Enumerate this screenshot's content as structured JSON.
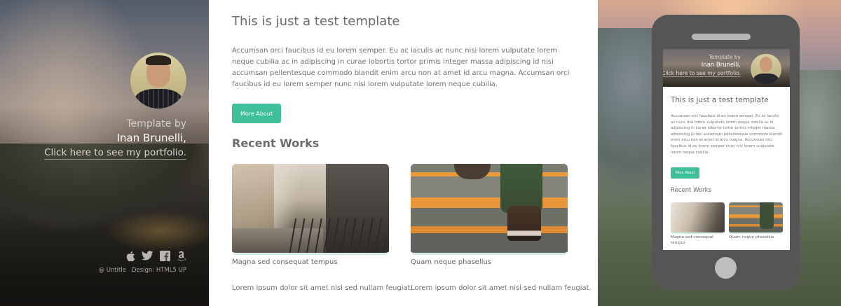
{
  "sidebar": {
    "template_by": "Template by",
    "author": "Inan Brunelli,",
    "portfolio_link": "Click here to see my portfolio.",
    "social_icons": [
      "apple-icon",
      "twitter-icon",
      "facebook-icon",
      "amazon-icon"
    ],
    "copyright": "@ Untitle",
    "design": "Design: HTML5 UP"
  },
  "main": {
    "title": "This is just a test template",
    "paragraph": "Accumsan orci faucibus id eu lorem semper. Eu ac iaculis ac nunc nisi lorem vulputate lorem neque cubilia ac in adipiscing in curae lobortis tortor primis integer massa adipiscing id nisi accumsan pellentesque commodo blandit enim arcu non at amet id arcu magna. Accumsan orci faucibus id eu lorem semper nunc nisi lorem vulputate lorem neque cubilia.",
    "button": "More About",
    "recent_title": "Recent Works",
    "works": [
      {
        "caption": "Magna sed consequat tempus",
        "description": "Lorem ipsum dolor sit amet nisl sed nullam feugiat."
      },
      {
        "caption": "Quam neque phasellus",
        "description": "Lorem ipsum dolor sit amet nisl sed nullam feugiat."
      }
    ]
  },
  "phone": {
    "header": {
      "template_by": "Template by",
      "author": "Inan Brunelli,",
      "portfolio_link": "Click here to see my portfolio."
    },
    "title": "This is just a test template",
    "paragraph": "Accumsan orci faucibus id eu lorem semper. Eu ac iaculis ac nunc nisi lorem vulputate lorem neque cubilia ac in adipiscing in curae lobortis tortor primis integer massa adipiscing id nisi accumsan pellentesque commodo blandit enim arcu non at amet id arcu magna. Accumsan orci faucibus id eu lorem semper nunc nisi lorem vulputate lorem neque cubilia.",
    "button": "More About",
    "recent_title": "Recent Works",
    "works": [
      {
        "caption": "Magna sed consequat tempus"
      },
      {
        "caption": "Quam neque phasellus"
      }
    ]
  },
  "colors": {
    "accent": "#3fbf9a",
    "heading": "#6b6b6b",
    "body_text": "#707070",
    "phone_body": "#555555"
  }
}
